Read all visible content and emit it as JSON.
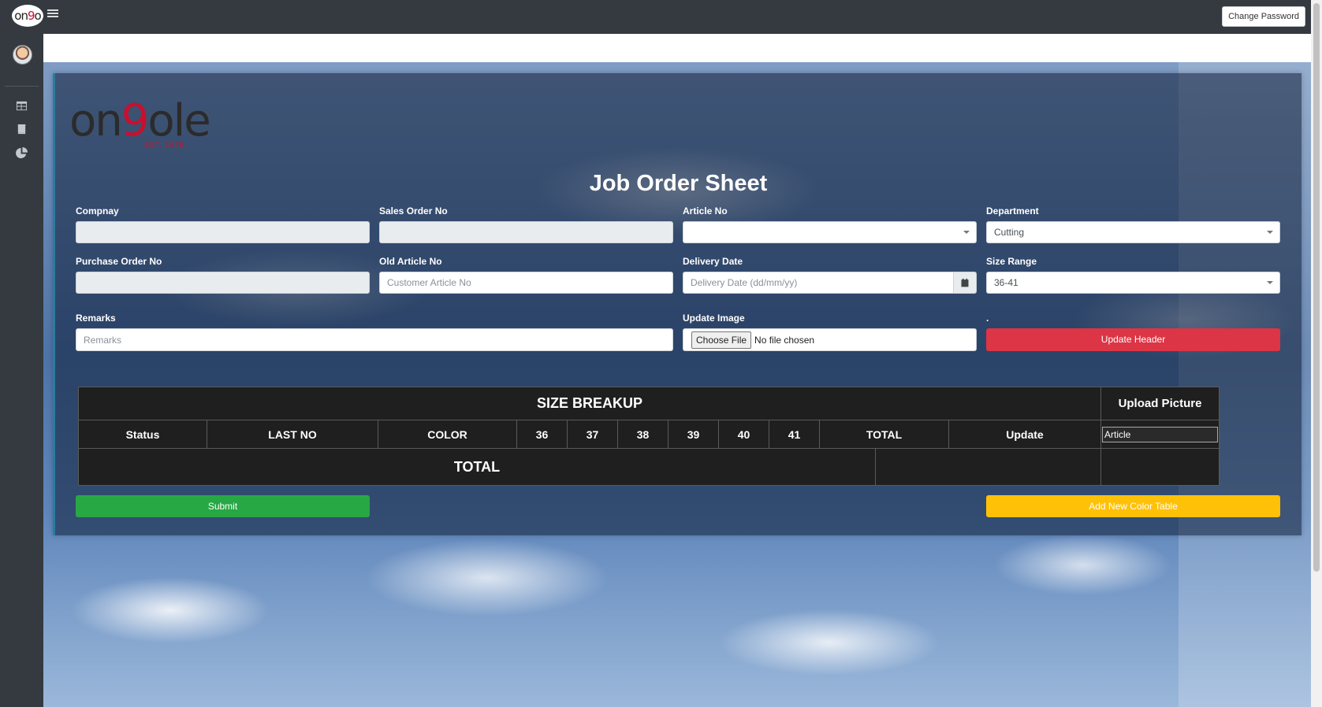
{
  "header": {
    "change_password_label": "Change Password"
  },
  "sidebar": {
    "items": [
      {
        "icon": "table-icon"
      },
      {
        "icon": "book-icon"
      },
      {
        "icon": "pie-chart-icon"
      }
    ]
  },
  "form": {
    "title": "Job Order Sheet",
    "company_label": "Compnay",
    "company_value": "",
    "sales_order_label": "Sales Order No",
    "sales_order_value": "",
    "article_no_label": "Article No",
    "article_no_value": "",
    "department_label": "Department",
    "department_value": "Cutting",
    "purchase_order_label": "Purchase Order No",
    "purchase_order_value": "",
    "old_article_label": "Old Article No",
    "old_article_placeholder": "Customer Article No",
    "delivery_date_label": "Delivery Date",
    "delivery_date_placeholder": "Delivery Date (dd/mm/yy)",
    "size_range_label": "Size Range",
    "size_range_value": "36-41",
    "remarks_label": "Remarks",
    "remarks_placeholder": "Remarks",
    "update_image_label": "Update Image",
    "choose_file_label": "Choose File",
    "no_file_label": "No file chosen",
    "dot_label": ".",
    "update_header_label": "Update Header",
    "submit_label": "Submit",
    "add_color_table_label": "Add New Color Table"
  },
  "table": {
    "size_breakup_label": "SIZE BREAKUP",
    "upload_picture_label": "Upload Picture",
    "columns": [
      "Status",
      "LAST NO",
      "COLOR",
      "36",
      "37",
      "38",
      "39",
      "40",
      "41",
      "TOTAL",
      "Update"
    ],
    "image_alt": "Article",
    "total_label": "TOTAL"
  },
  "colors": {
    "topbar": "#343a40",
    "danger": "#dc3545",
    "success": "#28a745",
    "warning": "#ffc107"
  }
}
